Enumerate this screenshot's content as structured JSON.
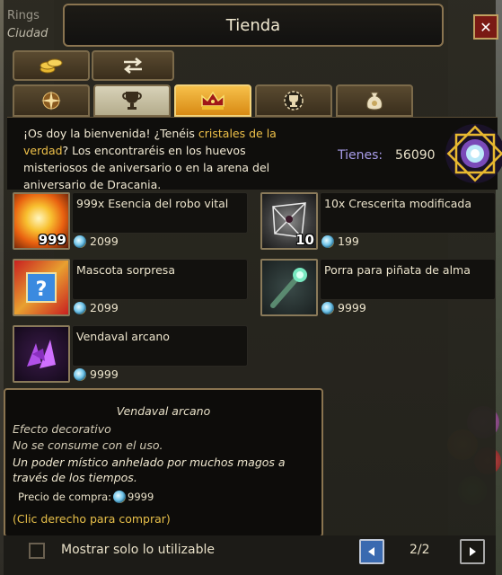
{
  "background": {
    "top_text": "Rings",
    "city": "Ciudad",
    "close_glyph": "✕"
  },
  "window": {
    "title": "Tienda"
  },
  "category_buttons": [
    {
      "icon": "gold-coins-icon"
    },
    {
      "icon": "exchange-arrows-icon"
    }
  ],
  "tabs": [
    {
      "icon": "compass-icon",
      "state": "normal"
    },
    {
      "icon": "trophy-icon",
      "state": "selected-light"
    },
    {
      "icon": "crown-icon",
      "state": "active"
    },
    {
      "icon": "medal-icon",
      "state": "normal"
    },
    {
      "icon": "money-bag-icon",
      "state": "normal"
    }
  ],
  "banner": {
    "text_part1": "¡Os doy la bienvenida! ¿Tenéis ",
    "highlight": "cristales de la verdad",
    "text_part2": "? Los encontraréis en los huevos misteriosos de aniversario o en la arena del aniversario de Dracania.",
    "tienes_label": "Tienes:",
    "tienes_value": "56090"
  },
  "items": [
    {
      "name": "999x Esencia del robo vital",
      "price": "2099",
      "quantity": "999",
      "icon": "sun-essence-icon"
    },
    {
      "name": "10x Crescerita modificada",
      "price": "199",
      "quantity": "10",
      "icon": "crystal-cage-icon"
    },
    {
      "name": "Mascota sorpresa",
      "price": "2099",
      "quantity": "",
      "icon": "mystery-pet-icon"
    },
    {
      "name": "Porra para piñata de alma",
      "price": "9999",
      "quantity": "",
      "icon": "pinata-club-icon"
    },
    {
      "name": "Vendaval arcano",
      "price": "9999",
      "quantity": "",
      "icon": "arcane-gale-icon"
    }
  ],
  "tooltip": {
    "title": "Vendaval arcano",
    "line1": "Efecto decorativo",
    "line2": "No se consume con el uso.",
    "description": "Un poder místico anhelado por muchos magos a través de los tiempos.",
    "price_label": "Precio de compra:",
    "price_value": "9999",
    "hint": "(Clic derecho para comprar)"
  },
  "footer": {
    "show_usable_label": "Mostrar solo lo utilizable",
    "page": "2/2"
  },
  "colors": {
    "accent_gold": "#f0c24a",
    "currency_label": "#a89ce8",
    "frame": "#8a7450"
  }
}
